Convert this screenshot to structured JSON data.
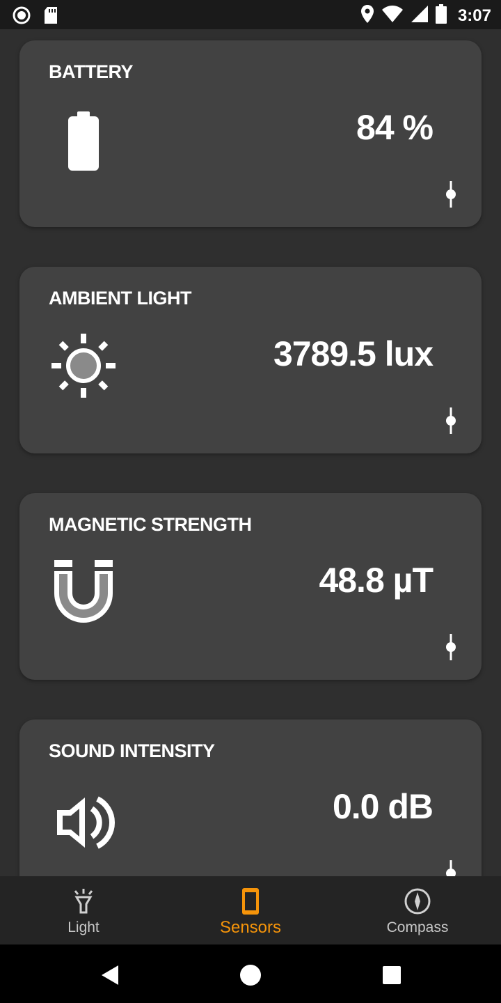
{
  "status_bar": {
    "time": "3:07",
    "icons": [
      "record-icon",
      "sd-card-icon",
      "location-icon",
      "wifi-icon",
      "signal-icon",
      "battery-icon"
    ]
  },
  "cards": [
    {
      "title": "BATTERY",
      "value": "84 %",
      "icon": "battery-icon"
    },
    {
      "title": "AMBIENT LIGHT",
      "value": "3789.5 lux",
      "icon": "sun-icon"
    },
    {
      "title": "MAGNETIC STRENGTH",
      "value": "48.8 µT",
      "icon": "magnet-icon"
    },
    {
      "title": "SOUND INTENSITY",
      "value": "0.0 dB",
      "icon": "speaker-icon"
    }
  ],
  "bottom_nav": {
    "items": [
      {
        "label": "Light",
        "icon": "flashlight-icon",
        "active": false
      },
      {
        "label": "Sensors",
        "icon": "phone-icon",
        "active": true
      },
      {
        "label": "Compass",
        "icon": "compass-icon",
        "active": false
      }
    ]
  },
  "colors": {
    "accent": "#f5940a",
    "card": "#424242",
    "background": "#2f2f2f"
  }
}
